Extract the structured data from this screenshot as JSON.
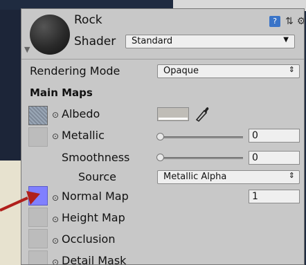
{
  "material": {
    "name": "Rock",
    "shader_label": "Shader",
    "shader_value": "Standard"
  },
  "rendering_mode": {
    "label": "Rendering Mode",
    "value": "Opaque"
  },
  "main_maps": {
    "title": "Main Maps",
    "albedo_label": "Albedo",
    "albedo_color": "#c0bdb7",
    "metallic_label": "Metallic",
    "metallic_value": "0",
    "smoothness_label": "Smoothness",
    "smoothness_value": "0",
    "source_label": "Source",
    "source_value": "Metallic Alpha",
    "normal_label": "Normal Map",
    "normal_value": "1",
    "height_label": "Height Map",
    "occlusion_label": "Occlusion",
    "detail_label": "Detail Mask"
  },
  "icons": {
    "help": "help-icon",
    "presets": "presets-icon",
    "settings": "gear-icon",
    "eyedropper": "eyedropper-icon",
    "pick": "object-picker-icon"
  },
  "colors": {
    "panel_bg": "#c8c8c8",
    "normal_map_swatch": "#8080ff",
    "arrow": "#b0201c"
  }
}
